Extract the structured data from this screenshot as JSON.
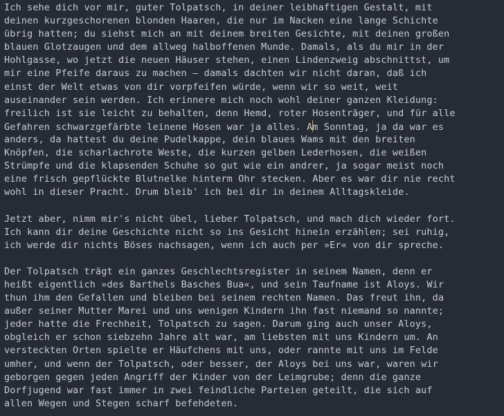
{
  "paragraphs": [
    [
      "Ich sehe dich vor mir, guter Tolpatsch, in deiner leibhaftigen Gestalt, mit",
      "deinen kurzgeschorenen blonden Haaren, die nur im Nacken eine lange Schichte",
      "übrig hatten; du siehst mich an mit deinem breiten Gesichte, mit deinen großen",
      "blauen Glotzaugen und dem allweg halboffenen Munde. Damals, als du mir in der",
      "Hohlgasse, wo jetzt die neuen Häuser stehen, einen Lindenzweig abschnittst, um",
      "mir eine Pfeife daraus zu machen – damals dachten wir nicht daran, daß ich",
      "einst der Welt etwas von dir vorpfeifen würde, wenn wir so weit, weit",
      "auseinander sein werden. Ich erinnere mich noch wohl deiner ganzen Kleidung:",
      "freilich ist sie leicht zu behalten, denn Hemd, roter Hosenträger, und für alle",
      "Gefahren schwarzgefärbte leinene Hosen war ja alles. Am Sonntag, ja da war es",
      "anders, da hattest du deine Pudelkappe, dein blaues Wams mit den breiten",
      "Knöpfen, die scharlachrote Weste, die kurzen gelben Lederhosen, die weißen",
      "Strümpfe und die klapsenden Schuhe so gut wie ein andrer, ja sogar meist noch",
      "eine frisch gepflückte Blutnelke hinterm Ohr stecken. Aber es war dir nie recht",
      "wohl in dieser Pracht. Drum bleib' ich bei dir in deinem Alltagskleide."
    ],
    [
      "Jetzt aber, nimm mir's nicht übel, lieber Tolpatsch, und mach dich wieder fort.",
      "Ich kann dir deine Geschichte nicht so ins Gesicht hinein erzählen; sei ruhig,",
      "ich werde dir nichts Böses nachsagen, wenn ich auch per »Er« von dir spreche."
    ],
    [
      "Der Tolpatsch trägt ein ganzes Geschlechtsregister in seinem Namen, denn er",
      "heißt eigentlich »des Barthels Basches Bua«, und sein Taufname ist Aloys. Wir",
      "thun ihm den Gefallen und bleiben bei seinem rechten Namen. Das freut ihn, da",
      "außer seiner Mutter Marei und uns wenigen Kindern ihn fast niemand so nannte;",
      "jeder hatte die Frechheit, Tolpatsch zu sagen. Darum ging auch unser Aloys,",
      "obgleich er schon siebzehn Jahre alt war, am liebsten mit uns Kindern um. An",
      "versteckten Orten spielte er Häufchens mit uns, oder rannte mit uns im Felde",
      "umher, und wenn der Tolpatsch, oder besser, der Aloys bei uns war, waren wir",
      "geborgen gegen jeden Angriff der Kinder von der Leimgrube; denn die ganze",
      "Dorfjugend war fast immer in zwei feindliche Parteien geteilt, die sich auf",
      "allen Wegen und Stegen scharf befehdeten."
    ]
  ],
  "cursor": {
    "paragraph": 0,
    "line": 9,
    "column": 54
  },
  "colors": {
    "background": "#272b34",
    "text": "#c7ccd6",
    "caret": "#e8a53a"
  }
}
